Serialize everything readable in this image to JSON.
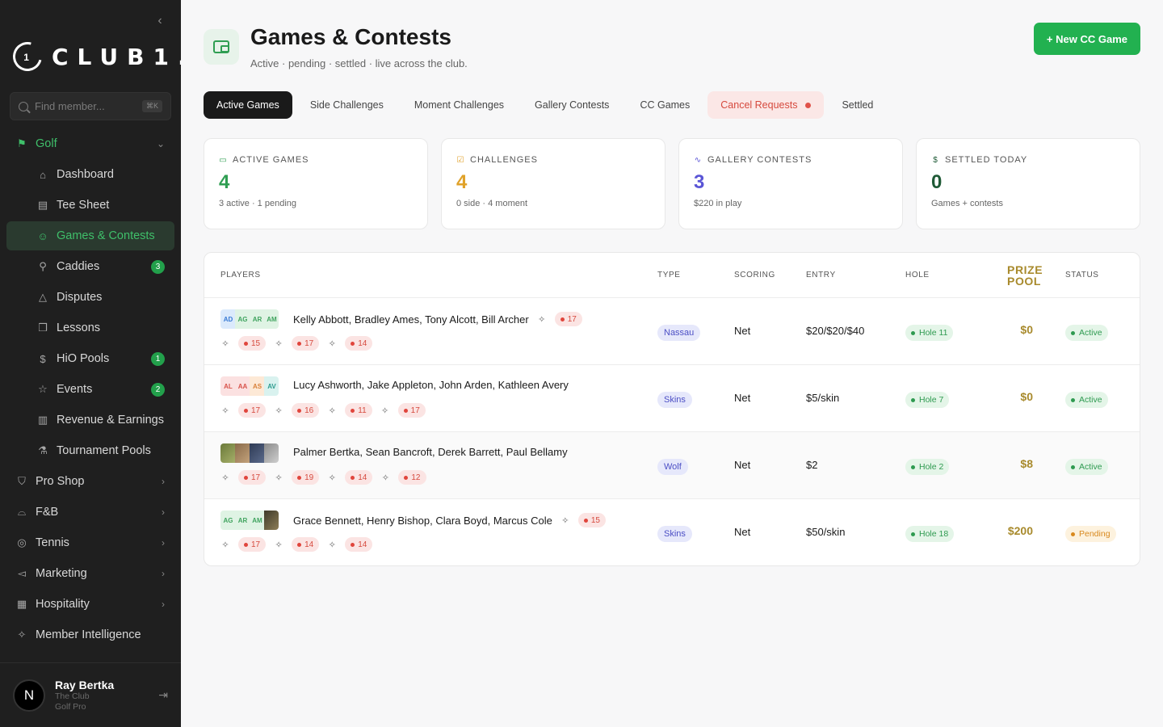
{
  "sidebar": {
    "logo_text": "CLUB1.",
    "logo_mark_text": "1",
    "search_placeholder": "Find member...",
    "search_shortcut": "⌘K",
    "items": [
      {
        "label": "Golf",
        "icon": "flag-icon",
        "glyph": "⚑",
        "type": "section",
        "expanded": true,
        "alert": true
      },
      {
        "label": "Dashboard",
        "icon": "home-icon",
        "glyph": "⌂",
        "type": "sub"
      },
      {
        "label": "Tee Sheet",
        "icon": "calendar-icon",
        "glyph": "▤",
        "type": "sub"
      },
      {
        "label": "Games & Contests",
        "icon": "smile-icon",
        "glyph": "☺",
        "type": "sub",
        "active": true
      },
      {
        "label": "Caddies",
        "icon": "person-icon",
        "glyph": "⚲",
        "type": "sub",
        "count": "3",
        "alert": true
      },
      {
        "label": "Disputes",
        "icon": "warning-icon",
        "glyph": "△",
        "type": "sub"
      },
      {
        "label": "Lessons",
        "icon": "book-icon",
        "glyph": "❒",
        "type": "sub"
      },
      {
        "label": "HiO Pools",
        "icon": "dollar-icon",
        "glyph": "$",
        "type": "sub",
        "count": "1",
        "alert": true
      },
      {
        "label": "Events",
        "icon": "star-icon",
        "glyph": "☆",
        "type": "sub",
        "count": "2",
        "alert": true
      },
      {
        "label": "Revenue & Earnings",
        "icon": "bar-chart-icon",
        "glyph": "▥",
        "type": "sub"
      },
      {
        "label": "Tournament Pools",
        "icon": "flask-icon",
        "glyph": "⚗",
        "type": "sub"
      },
      {
        "label": "Pro Shop",
        "icon": "bag-icon",
        "glyph": "⛉",
        "type": "section",
        "chevron": true
      },
      {
        "label": "F&B",
        "icon": "food-icon",
        "glyph": "⌓",
        "type": "section",
        "chevron": true
      },
      {
        "label": "Tennis",
        "icon": "tennis-icon",
        "glyph": "◎",
        "type": "section",
        "chevron": true
      },
      {
        "label": "Marketing",
        "icon": "megaphone-icon",
        "glyph": "◅",
        "type": "section",
        "chevron": true
      },
      {
        "label": "Hospitality",
        "icon": "building-icon",
        "glyph": "▦",
        "type": "section",
        "chevron": true
      },
      {
        "label": "Member Intelligence",
        "icon": "sparkle-icon",
        "glyph": "✧",
        "type": "section"
      }
    ],
    "user": {
      "initial": "N",
      "name": "Ray Bertka",
      "club": "The Club",
      "role": "Golf Pro"
    }
  },
  "header": {
    "title": "Games & Contests",
    "subtitle": "Active · pending · settled · live across the club.",
    "new_button": "+ New CC Game"
  },
  "tabs": [
    {
      "label": "Active Games",
      "active": true
    },
    {
      "label": "Side Challenges"
    },
    {
      "label": "Moment Challenges"
    },
    {
      "label": "Gallery Contests"
    },
    {
      "label": "CC Games"
    },
    {
      "label": "Cancel Requests",
      "alert": true
    },
    {
      "label": "Settled"
    }
  ],
  "stats": [
    {
      "label": "ACTIVE GAMES",
      "icon": "wallet-icon",
      "glyph": "▭",
      "value": "4",
      "sub": "3 active · 1 pending",
      "color": "#2f9e52"
    },
    {
      "label": "CHALLENGES",
      "icon": "checkbox-icon",
      "glyph": "☑",
      "value": "4",
      "sub": "0 side · 4 moment",
      "color": "#e0a22a"
    },
    {
      "label": "GALLERY CONTESTS",
      "icon": "activity-icon",
      "glyph": "∿",
      "value": "3",
      "sub": "$220 in play",
      "color": "#5a55d6"
    },
    {
      "label": "SETTLED TODAY",
      "icon": "dollar-icon",
      "glyph": "$",
      "value": "0",
      "sub": "Games + contests",
      "color": "#1f5a36"
    }
  ],
  "table": {
    "headers": {
      "players": "PLAYERS",
      "type": "TYPE",
      "scoring": "SCORING",
      "entry": "ENTRY",
      "hole": "HOLE",
      "prize_1": "PRIZE",
      "prize_2": "POOL",
      "status": "STATUS"
    },
    "rows": [
      {
        "avatars": [
          {
            "t": "AD",
            "c": "blue"
          },
          {
            "t": "AG",
            "c": "green"
          },
          {
            "t": "AR",
            "c": "green"
          },
          {
            "t": "AM",
            "c": "green"
          }
        ],
        "players": "Kelly Abbott, Bradley Ames, Tony Alcott, Bill Archer",
        "inline_chip": "17",
        "chips": [
          "15",
          "17",
          "14"
        ],
        "type": "Nassau",
        "scoring": "Net",
        "entry": "$20/$20/$40",
        "hole": "Hole 11",
        "prize": "$0",
        "status": "Active",
        "pending": false
      },
      {
        "avatars": [
          {
            "t": "AL",
            "c": "red"
          },
          {
            "t": "AA",
            "c": "red"
          },
          {
            "t": "AS",
            "c": "orange"
          },
          {
            "t": "AV",
            "c": "teal"
          }
        ],
        "players": "Lucy Ashworth, Jake Appleton, John Arden, Kathleen Avery",
        "inline_chip": "",
        "chips": [
          "17",
          "16",
          "11",
          "17"
        ],
        "type": "Skins",
        "scoring": "Net",
        "entry": "$5/skin",
        "hole": "Hole 7",
        "prize": "$0",
        "status": "Active",
        "pending": false
      },
      {
        "avatars": [
          {
            "t": "",
            "c": "photo1"
          },
          {
            "t": "",
            "c": "photo2"
          },
          {
            "t": "",
            "c": "photo3"
          },
          {
            "t": "",
            "c": "photo4"
          }
        ],
        "players": "Palmer Bertka, Sean Bancroft, Derek Barrett, Paul Bellamy",
        "inline_chip": "",
        "chips": [
          "17",
          "19",
          "14",
          "12"
        ],
        "type": "Wolf",
        "scoring": "Net",
        "entry": "$2",
        "hole": "Hole 2",
        "prize": "$8",
        "status": "Active",
        "pending": false
      },
      {
        "avatars": [
          {
            "t": "AG",
            "c": "green"
          },
          {
            "t": "AR",
            "c": "green"
          },
          {
            "t": "AM",
            "c": "green"
          },
          {
            "t": "",
            "c": "photo5"
          }
        ],
        "players": "Grace Bennett, Henry Bishop, Clara Boyd, Marcus Cole",
        "inline_chip": "15",
        "chips": [
          "17",
          "14",
          "14"
        ],
        "type": "Skins",
        "scoring": "Net",
        "entry": "$50/skin",
        "hole": "Hole 18",
        "prize": "$200",
        "status": "Pending",
        "pending": true
      }
    ]
  }
}
